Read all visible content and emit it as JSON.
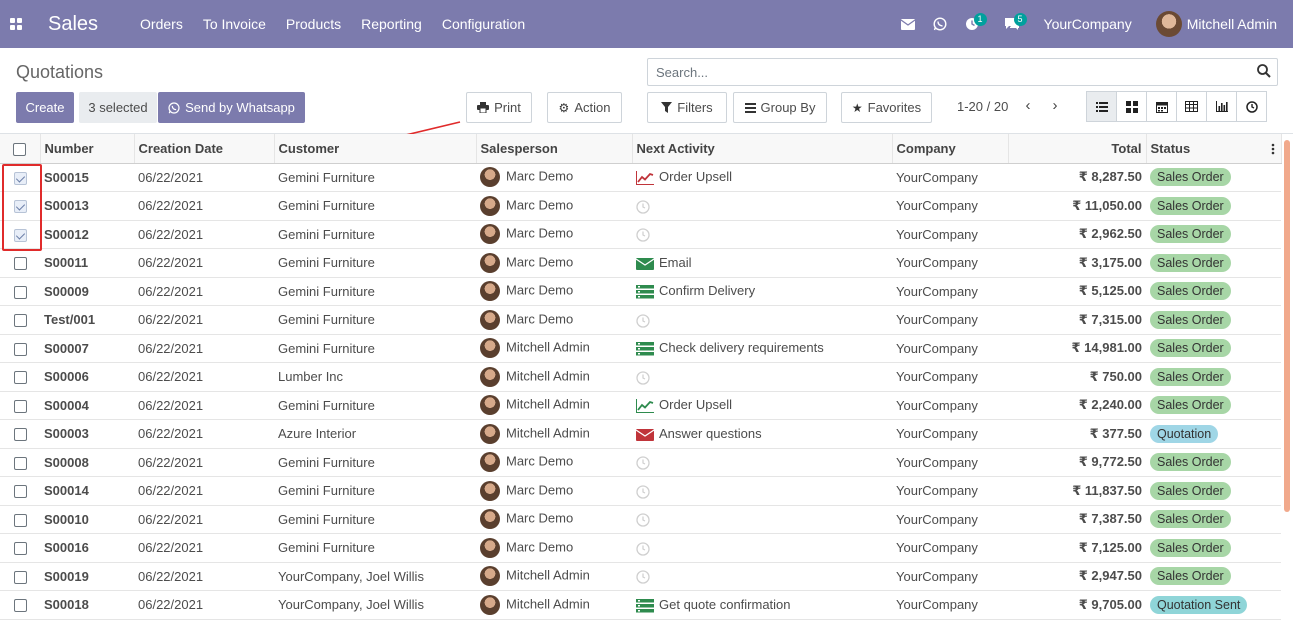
{
  "navbar": {
    "app_name": "Sales",
    "menu": [
      "Orders",
      "To Invoice",
      "Products",
      "Reporting",
      "Configuration"
    ],
    "activity_badge": "1",
    "messages_badge": "5",
    "company": "YourCompany",
    "user": "Mitchell Admin",
    "color": "#7c7bad"
  },
  "control": {
    "title": "Quotations",
    "create_label": "Create",
    "selected_label": "3 selected",
    "whatsapp_label": "Send by Whatsapp",
    "print_label": "Print",
    "action_label": "Action",
    "search_placeholder": "Search...",
    "filters_label": "Filters",
    "groupby_label": "Group By",
    "favorites_label": "Favorites",
    "pager": "1-20 / 20"
  },
  "table": {
    "headers": [
      "Number",
      "Creation Date",
      "Customer",
      "Salesperson",
      "Next Activity",
      "Company",
      "Total",
      "Status"
    ],
    "rows": [
      {
        "checked": true,
        "number": "S00015",
        "date": "06/22/2021",
        "customer": "Gemini Furniture",
        "salesperson": "Marc Demo",
        "activity_icon": "upsell",
        "activity": "Order Upsell",
        "company": "YourCompany",
        "total": "₹ 8,287.50",
        "status": "Sales Order",
        "status_kind": "so"
      },
      {
        "checked": true,
        "number": "S00013",
        "date": "06/22/2021",
        "customer": "Gemini Furniture",
        "salesperson": "Marc Demo",
        "activity_icon": "clock",
        "activity": "",
        "company": "YourCompany",
        "total": "₹ 11,050.00",
        "status": "Sales Order",
        "status_kind": "so"
      },
      {
        "checked": true,
        "number": "S00012",
        "date": "06/22/2021",
        "customer": "Gemini Furniture",
        "salesperson": "Marc Demo",
        "activity_icon": "clock",
        "activity": "",
        "company": "YourCompany",
        "total": "₹ 2,962.50",
        "status": "Sales Order",
        "status_kind": "so"
      },
      {
        "checked": false,
        "number": "S00011",
        "date": "06/22/2021",
        "customer": "Gemini Furniture",
        "salesperson": "Marc Demo",
        "activity_icon": "email",
        "activity": "Email",
        "company": "YourCompany",
        "total": "₹ 3,175.00",
        "status": "Sales Order",
        "status_kind": "so"
      },
      {
        "checked": false,
        "number": "S00009",
        "date": "06/22/2021",
        "customer": "Gemini Furniture",
        "salesperson": "Marc Demo",
        "activity_icon": "tasks",
        "activity": "Confirm Delivery",
        "company": "YourCompany",
        "total": "₹ 5,125.00",
        "status": "Sales Order",
        "status_kind": "so"
      },
      {
        "checked": false,
        "number": "Test/001",
        "date": "06/22/2021",
        "customer": "Gemini Furniture",
        "salesperson": "Marc Demo",
        "activity_icon": "clock",
        "activity": "",
        "company": "YourCompany",
        "total": "₹ 7,315.00",
        "status": "Sales Order",
        "status_kind": "so"
      },
      {
        "checked": false,
        "number": "S00007",
        "date": "06/22/2021",
        "customer": "Gemini Furniture",
        "salesperson": "Mitchell Admin",
        "activity_icon": "tasks",
        "activity": "Check delivery requirements",
        "company": "YourCompany",
        "total": "₹ 14,981.00",
        "status": "Sales Order",
        "status_kind": "so"
      },
      {
        "checked": false,
        "number": "S00006",
        "date": "06/22/2021",
        "customer": "Lumber Inc",
        "salesperson": "Mitchell Admin",
        "activity_icon": "clock",
        "activity": "",
        "company": "YourCompany",
        "total": "₹ 750.00",
        "status": "Sales Order",
        "status_kind": "so"
      },
      {
        "checked": false,
        "number": "S00004",
        "date": "06/22/2021",
        "customer": "Gemini Furniture",
        "salesperson": "Mitchell Admin",
        "activity_icon": "upsell-g",
        "activity": "Order Upsell",
        "company": "YourCompany",
        "total": "₹ 2,240.00",
        "status": "Sales Order",
        "status_kind": "so"
      },
      {
        "checked": false,
        "number": "S00003",
        "date": "06/22/2021",
        "customer": "Azure Interior",
        "salesperson": "Mitchell Admin",
        "activity_icon": "email-r",
        "activity": "Answer questions",
        "company": "YourCompany",
        "total": "₹ 377.50",
        "status": "Quotation",
        "status_kind": "q"
      },
      {
        "checked": false,
        "number": "S00008",
        "date": "06/22/2021",
        "customer": "Gemini Furniture",
        "salesperson": "Marc Demo",
        "activity_icon": "clock",
        "activity": "",
        "company": "YourCompany",
        "total": "₹ 9,772.50",
        "status": "Sales Order",
        "status_kind": "so"
      },
      {
        "checked": false,
        "number": "S00014",
        "date": "06/22/2021",
        "customer": "Gemini Furniture",
        "salesperson": "Marc Demo",
        "activity_icon": "clock",
        "activity": "",
        "company": "YourCompany",
        "total": "₹ 11,837.50",
        "status": "Sales Order",
        "status_kind": "so"
      },
      {
        "checked": false,
        "number": "S00010",
        "date": "06/22/2021",
        "customer": "Gemini Furniture",
        "salesperson": "Marc Demo",
        "activity_icon": "clock",
        "activity": "",
        "company": "YourCompany",
        "total": "₹ 7,387.50",
        "status": "Sales Order",
        "status_kind": "so"
      },
      {
        "checked": false,
        "number": "S00016",
        "date": "06/22/2021",
        "customer": "Gemini Furniture",
        "salesperson": "Marc Demo",
        "activity_icon": "clock",
        "activity": "",
        "company": "YourCompany",
        "total": "₹ 7,125.00",
        "status": "Sales Order",
        "status_kind": "so"
      },
      {
        "checked": false,
        "number": "S00019",
        "date": "06/22/2021",
        "customer": "YourCompany, Joel Willis",
        "salesperson": "Mitchell Admin",
        "activity_icon": "clock",
        "activity": "",
        "company": "YourCompany",
        "total": "₹ 2,947.50",
        "status": "Sales Order",
        "status_kind": "so"
      },
      {
        "checked": false,
        "number": "S00018",
        "date": "06/22/2021",
        "customer": "YourCompany, Joel Willis",
        "salesperson": "Mitchell Admin",
        "activity_icon": "tasks",
        "activity": "Get quote confirmation",
        "company": "YourCompany",
        "total": "₹ 9,705.00",
        "status": "Quotation Sent",
        "status_kind": "qs"
      }
    ]
  }
}
